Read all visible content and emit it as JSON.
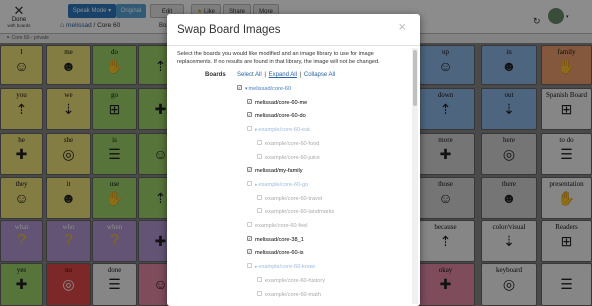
{
  "toolbar": {
    "done_label": "Done",
    "done_sub": "with boards",
    "speak_mode": "Speak Mode",
    "original": "Original",
    "edit_board": "Edit Board",
    "like": "Like",
    "share": "Share",
    "more": "More",
    "breadcrumb_user": "melissad",
    "breadcrumb_board": "Core 60",
    "public_label": "Core 60 - private"
  },
  "grid": {
    "words": [
      [
        "I",
        "me",
        "do",
        "",
        "",
        "",
        "",
        "",
        "",
        "up",
        "in",
        "family"
      ],
      [
        "you",
        "we",
        "go",
        "",
        "",
        "",
        "",
        "",
        "",
        "down",
        "out",
        "Spanish Board"
      ],
      [
        "he",
        "she",
        "is",
        "",
        "",
        "",
        "",
        "",
        "",
        "more",
        "here",
        "to do"
      ],
      [
        "they",
        "it",
        "use",
        "",
        "",
        "",
        "",
        "",
        "",
        "those",
        "there",
        "presentation"
      ],
      [
        "what",
        "who",
        "when",
        "",
        "",
        "",
        "",
        "",
        "",
        "because",
        "color/visual",
        "Readers"
      ],
      [
        "yes",
        "no",
        "done",
        "",
        "",
        "",
        "",
        "",
        "",
        "okay",
        "keyboard",
        ""
      ]
    ]
  },
  "modal": {
    "title": "Swap Board Images",
    "close": "×",
    "description": "Select the boards you would like modified and an image library to use for image replacements. If no results are found in that library, the image will not be changed.",
    "boards_label": "Boards",
    "select_all": "Select All",
    "expand_all": "Expand All",
    "collapse_all": "Collapse All",
    "tree": [
      {
        "label": "melissad/core-60",
        "checked": true,
        "indent": 0,
        "caret": "▾",
        "link": true,
        "dim": false
      },
      {
        "label": "melissad/core-60-me",
        "checked": true,
        "indent": 1,
        "caret": "",
        "link": false,
        "dim": false
      },
      {
        "label": "melissad/core-60-do",
        "checked": true,
        "indent": 1,
        "caret": "",
        "link": false,
        "dim": false
      },
      {
        "label": "example/core-60-eat",
        "checked": false,
        "indent": 1,
        "caret": "▸",
        "link": true,
        "dim": true
      },
      {
        "label": "example/core-60-food",
        "checked": false,
        "indent": 2,
        "caret": "",
        "link": false,
        "dim": true
      },
      {
        "label": "example/core-60-juice",
        "checked": false,
        "indent": 2,
        "caret": "",
        "link": false,
        "dim": true
      },
      {
        "label": "melissad/my-family",
        "checked": true,
        "indent": 1,
        "caret": "",
        "link": false,
        "dim": false
      },
      {
        "label": "example/core-60-go",
        "checked": false,
        "indent": 1,
        "caret": "▸",
        "link": true,
        "dim": true
      },
      {
        "label": "example/core-60-travel",
        "checked": false,
        "indent": 2,
        "caret": "",
        "link": false,
        "dim": true
      },
      {
        "label": "example/core-60-landmarks",
        "checked": false,
        "indent": 2,
        "caret": "",
        "link": false,
        "dim": true
      },
      {
        "label": "example/core-60-feel",
        "checked": false,
        "indent": 1,
        "caret": "",
        "link": false,
        "dim": true
      },
      {
        "label": "melissad/core-38_1",
        "checked": true,
        "indent": 1,
        "caret": "",
        "link": false,
        "dim": false
      },
      {
        "label": "melissad/core-60-is",
        "checked": true,
        "indent": 1,
        "caret": "",
        "link": false,
        "dim": false
      },
      {
        "label": "example/core-60-know",
        "checked": false,
        "indent": 1,
        "caret": "▸",
        "link": true,
        "dim": true
      },
      {
        "label": "example/core-60-history",
        "checked": false,
        "indent": 2,
        "caret": "",
        "link": false,
        "dim": true
      },
      {
        "label": "example/core-60-math",
        "checked": false,
        "indent": 2,
        "caret": "",
        "link": false,
        "dim": true
      }
    ]
  }
}
